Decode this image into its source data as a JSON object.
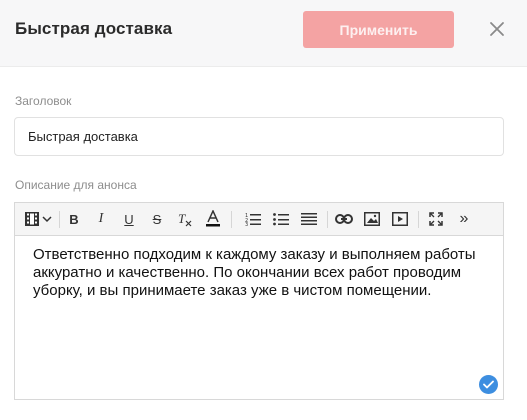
{
  "header": {
    "title": "Быстрая доставка",
    "apply_label": "Применить",
    "close_icon": "close-icon"
  },
  "form": {
    "title_label": "Заголовок",
    "title_value": "Быстрая доставка",
    "description_label": "Описание для анонса"
  },
  "editor": {
    "toolbar": [
      {
        "name": "paragraph-format-icon",
        "glyph": "film"
      },
      {
        "name": "bold-icon",
        "glyph": "B"
      },
      {
        "name": "italic-icon",
        "glyph": "I"
      },
      {
        "name": "underline-icon",
        "glyph": "U"
      },
      {
        "name": "strikethrough-icon",
        "glyph": "S"
      },
      {
        "name": "clear-formatting-icon",
        "glyph": "Tx"
      },
      {
        "name": "text-color-icon",
        "glyph": "A"
      },
      {
        "name": "ordered-list-icon",
        "glyph": "ol"
      },
      {
        "name": "unordered-list-icon",
        "glyph": "ul"
      },
      {
        "name": "align-icon",
        "glyph": "align"
      },
      {
        "name": "link-icon",
        "glyph": "link"
      },
      {
        "name": "image-icon",
        "glyph": "image"
      },
      {
        "name": "video-icon",
        "glyph": "video"
      },
      {
        "name": "fullscreen-icon",
        "glyph": "fullscreen"
      },
      {
        "name": "more-icon",
        "glyph": "»"
      }
    ],
    "content": "Ответственно подходим к каждому заказу и выполняем работы аккуратно и качественно. По окончании всех работ проводим уборку, и вы принимаете заказ уже в чистом помещении.",
    "status_icon": "check-circle-icon"
  },
  "colors": {
    "accent": "#f4a3a3",
    "check": "#3d8ee0",
    "header_bg": "#f7f7f8"
  }
}
